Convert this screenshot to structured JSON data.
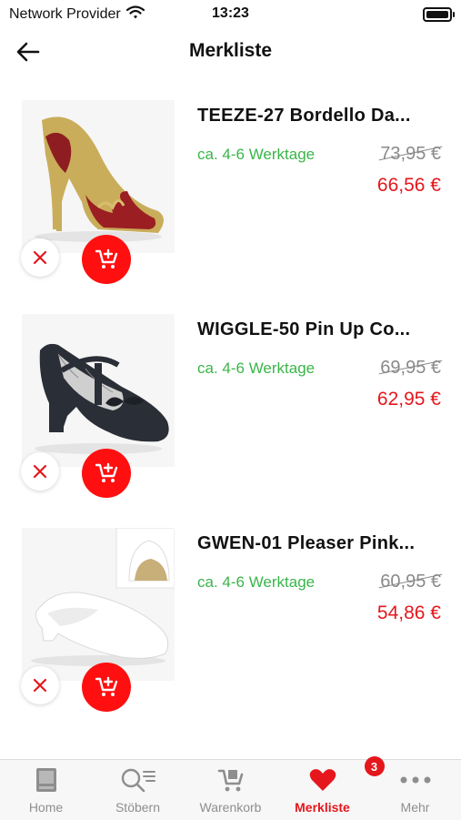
{
  "status_bar": {
    "carrier": "Network Provider",
    "time": "13:23"
  },
  "header": {
    "title": "Merkliste"
  },
  "items": [
    {
      "name": "TEEZE-27 Bordello Da...",
      "delivery": "ca. 4-6 Werktage",
      "old_price": "73,95 €",
      "new_price": "66,56 €"
    },
    {
      "name": "WIGGLE-50 Pin Up Co...",
      "delivery": "ca. 4-6 Werktage",
      "old_price": "69,95 €",
      "new_price": "62,95 €"
    },
    {
      "name": "GWEN-01 Pleaser Pink...",
      "delivery": "ca. 4-6 Werktage",
      "old_price": "60,95 €",
      "new_price": "54,86 €"
    }
  ],
  "bottom_nav": {
    "items": [
      {
        "label": "Home",
        "icon": "home-icon"
      },
      {
        "label": "Stöbern",
        "icon": "browse-search-icon"
      },
      {
        "label": "Warenkorb",
        "icon": "cart-icon"
      },
      {
        "label": "Merkliste",
        "icon": "heart-icon",
        "badge": "3",
        "active": true
      },
      {
        "label": "Mehr",
        "icon": "more-dots-icon"
      }
    ]
  },
  "colors": {
    "accent": "#e5171c",
    "cart_button": "#ff0f0f",
    "delivery": "#3ab54a",
    "old_price": "#8a8a8a"
  }
}
